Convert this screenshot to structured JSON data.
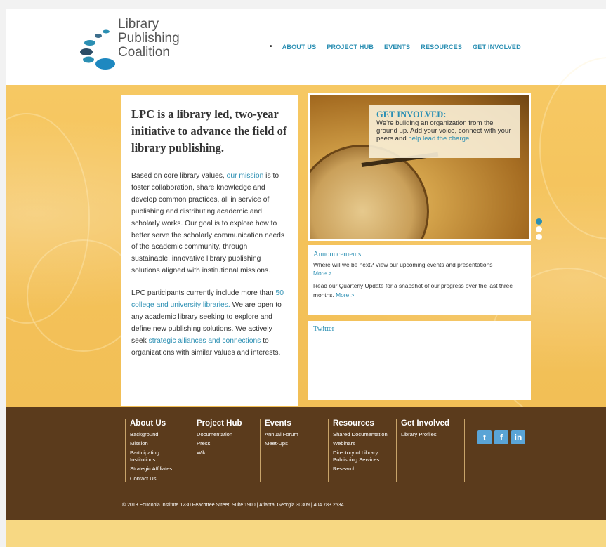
{
  "logo": {
    "lines": [
      "Library",
      "Publishing",
      "Coalition"
    ]
  },
  "nav": {
    "items": [
      "ABOUT US",
      "PROJECT HUB",
      "EVENTS",
      "RESOURCES",
      "GET INVOLVED"
    ]
  },
  "intro": {
    "heading": "LPC is a library led, two-year initiative to advance the field of library publishing.",
    "p1_a": "Based on core library values, ",
    "p1_link": "our mission",
    "p1_b": " is to foster collaboration, share knowledge and develop common practices, all in service of publishing and distributing academic and scholarly works. Our goal is to explore how to better serve the scholarly communication needs of the academic community, through sustainable, innovative library publishing solutions aligned with institutional missions.",
    "p2_a": "LPC participants currently include more than ",
    "p2_link1": "50 college and university libraries.",
    "p2_b": " We are open to any academic library seeking to explore and define new publishing solutions. We actively seek ",
    "p2_link2": "strategic alliances and connections",
    "p2_c": " to organizations with similar values and interests."
  },
  "hero": {
    "title": "GET INVOLVED:",
    "text": "We're building an organization from the ground up. Add your voice, connect with your peers and ",
    "link": "help lead the charge."
  },
  "announcements": {
    "title": "Announcements",
    "item1": "Where will we be next? View our upcoming events and presentations",
    "more": "More >",
    "item2": "Read our Quarterly Update for a snapshot of our progress over the last three months. ",
    "more2": "More >"
  },
  "twitter": {
    "title": "Twitter"
  },
  "footer": {
    "columns": [
      {
        "title": "About Us",
        "links": [
          "Background",
          "Mission",
          "Participating Institutions",
          "Strategic Affiliates",
          "Contact Us"
        ]
      },
      {
        "title": "Project Hub",
        "links": [
          "Documentation",
          "Press",
          "Wiki"
        ]
      },
      {
        "title": "Events",
        "links": [
          "Annual Forum",
          "Meet-Ups"
        ]
      },
      {
        "title": "Resources",
        "links": [
          "Shared Documentation",
          "Webinars",
          "Directory of Library Publishing Services",
          "Research"
        ]
      },
      {
        "title": "Get Involved",
        "links": [
          "Library Profiles"
        ]
      }
    ],
    "social": [
      "t",
      "f",
      "in"
    ],
    "copyright": "© 2013 Educopia Institute   1230 Peachtree Street, Suite 1900  |  Atlanta, Georgia 30309  |  404.783.2534"
  },
  "colors": {
    "accent": "#2b8fb3",
    "band": "#f4c25a",
    "footer": "#5b3b1c"
  }
}
